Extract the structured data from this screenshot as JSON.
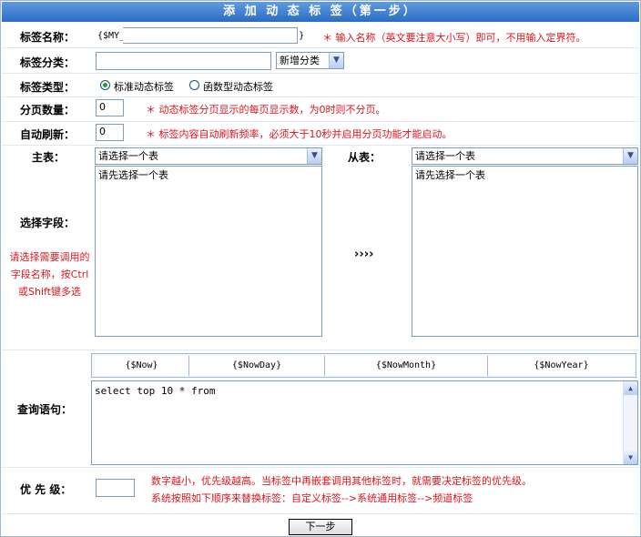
{
  "title": "添 加 动 态 标 签（第一步）",
  "tag_name": {
    "label": "标签名称：",
    "prefix": "{$MY_",
    "suffix": "}",
    "value": "",
    "hint": "＊ 输入名称（英文要注意大小写）即可，不用输入定界符。"
  },
  "category": {
    "label": "标签分类：",
    "value": "",
    "select_value": "新增分类"
  },
  "tag_type": {
    "label": "标签类型：",
    "options": [
      "标准动态标签",
      "函数型动态标签"
    ],
    "selected_index": 0
  },
  "page_size": {
    "label": "分页数量：",
    "value": "0",
    "hint": "＊ 动态标签分页显示的每页显示数，为0时则不分页。"
  },
  "auto_refresh": {
    "label": "自动刷新：",
    "value": "0",
    "hint": "＊ 标签内容自动刷新频率，必须大于10秒并启用分页功能才能启动。"
  },
  "main_table": {
    "label": "主表：",
    "select_value": "请选择一个表",
    "list_placeholder": "请先选择一个表"
  },
  "sub_table": {
    "label": "从表：",
    "select_value": "请选择一个表",
    "list_placeholder": "请先选择一个表"
  },
  "fields": {
    "label": "选择字段：",
    "hint_lines": [
      "请选择需要调用的",
      "字段名称，按Ctrl",
      "或Shift键多选"
    ],
    "arrow": "››››"
  },
  "query": {
    "label": "查询语句：",
    "vars": [
      "{$Now}",
      "{$NowDay}",
      "{$NowMonth}",
      "{$NowYear}"
    ],
    "value": "select top 10 * from"
  },
  "priority": {
    "label": "优 先 级：",
    "value": "",
    "hint_lines": [
      "数字越小，优先级越高。当标签中再嵌套调用其他标签时，就需要决定标签的优先级。",
      "系统按照如下顺序来替换标签：自定义标签-->系统通用标签-->频道标签"
    ]
  },
  "next_button": "下一步",
  "colors": {
    "title_bar": "#2b6cc4",
    "hint": "#e0141b",
    "border": "#7f9db9"
  }
}
